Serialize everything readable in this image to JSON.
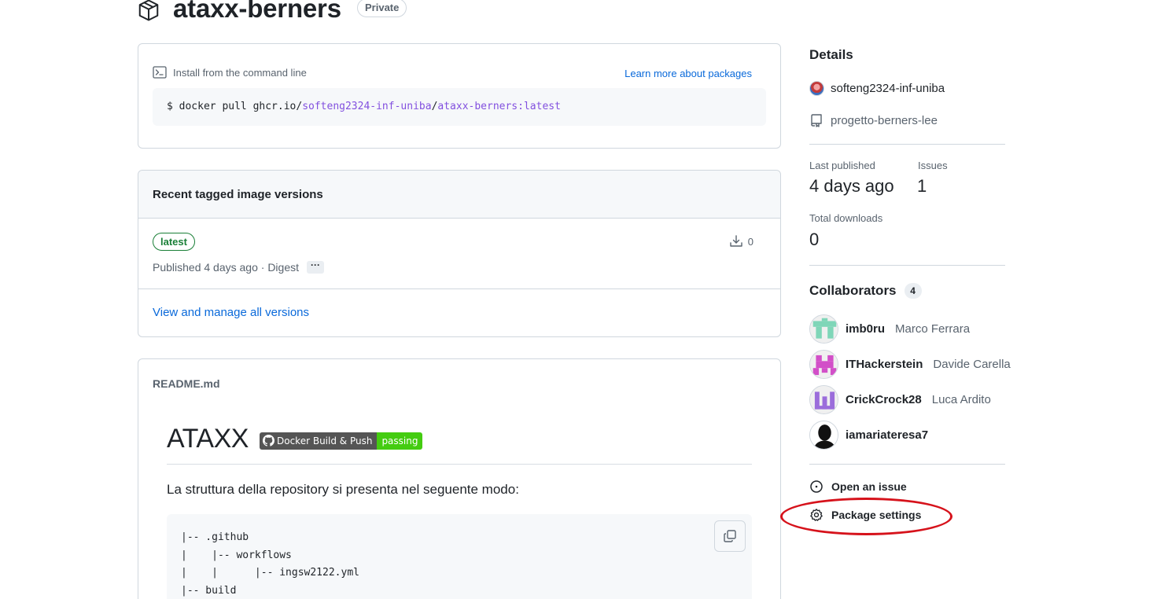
{
  "header": {
    "package_name": "ataxx-berners",
    "visibility": "Private",
    "package_icon": "package-icon"
  },
  "install": {
    "title": "Install from the command line",
    "learn_more": "Learn more about packages",
    "cmd_prefix": "$ docker pull ghcr.io/",
    "cmd_owner": "softeng2324-inf-uniba",
    "cmd_sep": "/",
    "cmd_image": "ataxx-berners:latest"
  },
  "versions": {
    "title": "Recent tagged image versions",
    "tag": "latest",
    "downloads": "0",
    "published": "Published 4 days ago · Digest",
    "digest_toggle": "···",
    "view_all": "View and manage all versions"
  },
  "readme": {
    "filename": "README.md",
    "heading": "ATAXX",
    "badge_label": "Docker Build & Push",
    "badge_status": "passing",
    "badge_status_color": "#44cc11",
    "paragraph": "La struttura della repository si presenta nel seguente modo:",
    "code": "|-- .github\n|    |-- workflows\n|    |      |-- ingsw2122.yml\n|-- build"
  },
  "sidebar": {
    "details_title": "Details",
    "owner": "softeng2324-inf-uniba",
    "repository": "progetto-berners-lee",
    "last_published_label": "Last published",
    "last_published_value": "4 days ago",
    "issues_label": "Issues",
    "issues_value": "1",
    "downloads_label": "Total downloads",
    "downloads_value": "0",
    "collaborators_title": "Collaborators",
    "collaborators_count": "4",
    "collaborators": [
      {
        "login": "imb0ru",
        "name": "Marco Ferrara",
        "avatar_color": "#7fd6b8"
      },
      {
        "login": "ITHackerstein",
        "name": "Davide Carella",
        "avatar_color": "#d24fc8"
      },
      {
        "login": "CrickCrock28",
        "name": "Luca Ardito",
        "avatar_color": "#9b6ddb"
      },
      {
        "login": "iamariateresa7",
        "name": "",
        "avatar_color": "#111111"
      }
    ],
    "open_issue": "Open an issue",
    "package_settings": "Package settings"
  },
  "annotation": {
    "highlight_color": "#d6121b",
    "highlight_target": "Package settings"
  }
}
